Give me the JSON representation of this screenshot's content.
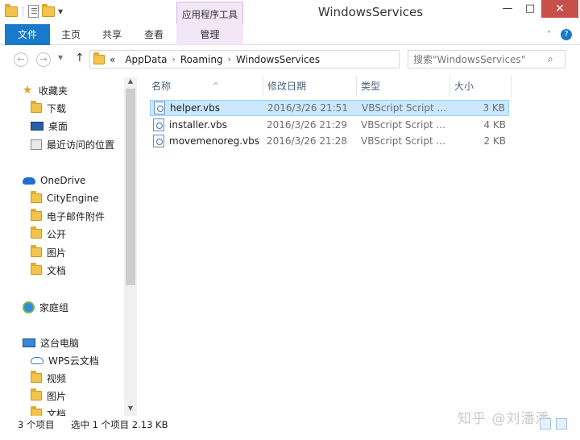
{
  "window": {
    "title": "WindowsServices",
    "context_group": "应用程序工具",
    "controls": {
      "minimize": "—",
      "maximize": "□",
      "close": "✕"
    }
  },
  "ribbon": {
    "tabs": [
      {
        "label": "文件"
      },
      {
        "label": "主页"
      },
      {
        "label": "共享"
      },
      {
        "label": "查看"
      },
      {
        "label": "管理"
      }
    ],
    "help": "?"
  },
  "nav": {
    "back": "←",
    "forward": "→",
    "up": "↑",
    "breadcrumb_prefix": "«",
    "breadcrumb": [
      "AppData",
      "Roaming",
      "WindowsServices"
    ],
    "refresh": "↻",
    "search_placeholder": "搜索\"WindowsServices\"",
    "search_icon": "⌕"
  },
  "sidebar": {
    "groups": [
      {
        "label": "收藏夹",
        "icon": "star-icon",
        "children": [
          "下载",
          "桌面",
          "最近访问的位置"
        ]
      },
      {
        "label": "OneDrive",
        "icon": "cloud-icon",
        "children": [
          "CityEngine",
          "电子邮件附件",
          "公开",
          "图片",
          "文档"
        ]
      },
      {
        "label": "家庭组",
        "icon": "homegroup-icon",
        "children": []
      },
      {
        "label": "这台电脑",
        "icon": "computer-icon",
        "children": [
          "WPS云文档",
          "视频",
          "图片",
          "文档"
        ]
      }
    ]
  },
  "content": {
    "columns": [
      "名称",
      "修改日期",
      "类型",
      "大小"
    ],
    "sort_caret": "^",
    "files": [
      {
        "name": "helper.vbs",
        "modified": "2016/3/26 21:51",
        "type": "VBScript Script ...",
        "size": "3 KB",
        "selected": true
      },
      {
        "name": "installer.vbs",
        "modified": "2016/3/26 21:29",
        "type": "VBScript Script ...",
        "size": "4 KB",
        "selected": false
      },
      {
        "name": "movemenoreg.vbs",
        "modified": "2016/3/26 21:28",
        "type": "VBScript Script ...",
        "size": "2 KB",
        "selected": false
      }
    ]
  },
  "status": {
    "item_count": "3 个项目",
    "selection": "选中 1 个项目  2.13 KB"
  },
  "watermark": "知乎 @刘潘潘"
}
